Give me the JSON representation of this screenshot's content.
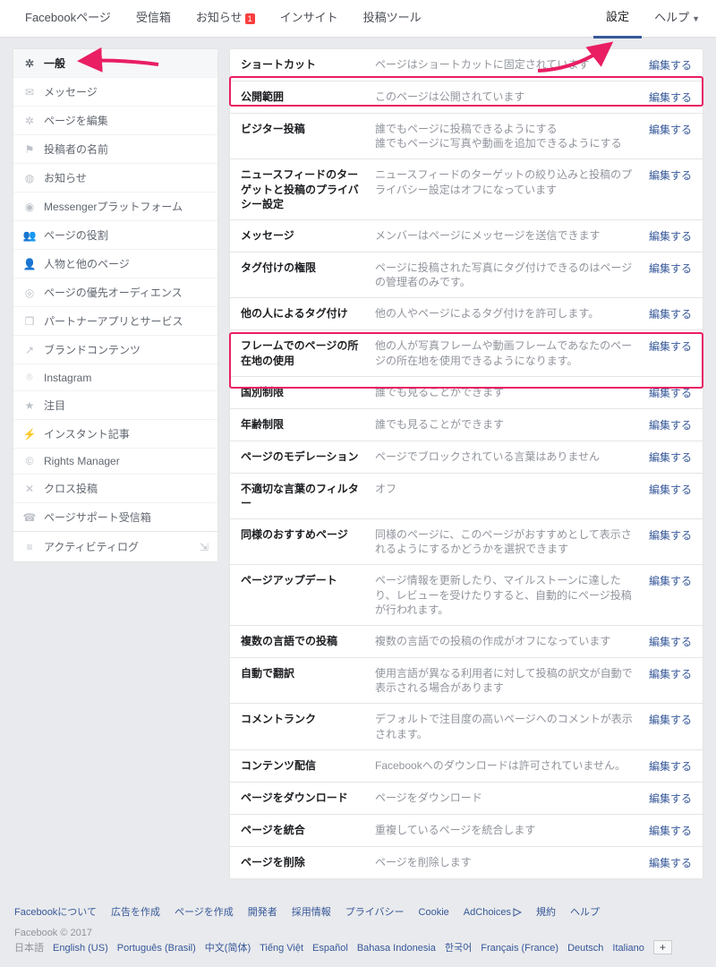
{
  "topnav": {
    "items": [
      {
        "label": "Facebookページ"
      },
      {
        "label": "受信箱"
      },
      {
        "label": "お知らせ",
        "badge": "1"
      },
      {
        "label": "インサイト"
      },
      {
        "label": "投稿ツール"
      }
    ],
    "settings": "設定",
    "help": "ヘルプ"
  },
  "sidebar": {
    "items": [
      {
        "icon": "gear",
        "label": "一般",
        "selected": true
      },
      {
        "icon": "message",
        "label": "メッセージ"
      },
      {
        "icon": "gear",
        "label": "ページを編集"
      },
      {
        "icon": "flag",
        "label": "投稿者の名前"
      },
      {
        "icon": "globe",
        "label": "お知らせ"
      },
      {
        "icon": "messenger",
        "label": "Messengerプラットフォーム"
      },
      {
        "icon": "people",
        "label": "ページの役割"
      },
      {
        "icon": "person",
        "label": "人物と他のページ"
      },
      {
        "icon": "target",
        "label": "ページの優先オーディエンス"
      },
      {
        "icon": "cube",
        "label": "パートナーアプリとサービス"
      },
      {
        "icon": "share",
        "label": "ブランドコンテンツ"
      },
      {
        "icon": "instagram",
        "label": "Instagram"
      },
      {
        "icon": "star",
        "label": "注目"
      },
      {
        "icon": "bolt",
        "label": "インスタント記事"
      },
      {
        "icon": "copyright",
        "label": "Rights Manager"
      },
      {
        "icon": "cross",
        "label": "クロス投稿"
      },
      {
        "icon": "support",
        "label": "ページサポート受信箱"
      }
    ],
    "activity_log": "アクティビティログ"
  },
  "settings_rows": [
    {
      "label": "ショートカット",
      "value": "ページはショートカットに固定されています",
      "edit": "編集する"
    },
    {
      "label": "公開範囲",
      "value": "このページは公開されています",
      "edit": "編集する"
    },
    {
      "label": "ビジター投稿",
      "value": "誰でもページに投稿できるようにする\n誰でもページに写真や動画を追加できるようにする",
      "edit": "編集する"
    },
    {
      "label": "ニュースフィードのターゲットと投稿のプライバシー設定",
      "value": "ニュースフィードのターゲットの絞り込みと投稿のプライバシー設定はオフになっています",
      "edit": "編集する"
    },
    {
      "label": "メッセージ",
      "value": "メンバーはページにメッセージを送信できます",
      "edit": "編集する"
    },
    {
      "label": "タグ付けの権限",
      "value": "ページに投稿された写真にタグ付けできるのはページの管理者のみです。",
      "edit": "編集する"
    },
    {
      "label": "他の人によるタグ付け",
      "value": "他の人やページによるタグ付けを許可します。",
      "edit": "編集する"
    },
    {
      "label": "フレームでのページの所在地の使用",
      "value": "他の人が写真フレームや動画フレームであなたのページの所在地を使用できるようになります。",
      "edit": "編集する"
    },
    {
      "label": "国別制限",
      "value": "誰でも見ることができます",
      "edit": "編集する"
    },
    {
      "label": "年齢制限",
      "value": "誰でも見ることができます",
      "edit": "編集する"
    },
    {
      "label": "ページのモデレーション",
      "value": "ページでブロックされている言葉はありません",
      "edit": "編集する"
    },
    {
      "label": "不適切な言葉のフィルター",
      "value": "オフ",
      "edit": "編集する"
    },
    {
      "label": "同様のおすすめページ",
      "value": "同様のページに、このページがおすすめとして表示されるようにするかどうかを選択できます",
      "edit": "編集する"
    },
    {
      "label": "ページアップデート",
      "value": "ページ情報を更新したり、マイルストーンに達したり、レビューを受けたりすると、自動的にページ投稿が行われます。",
      "edit": "編集する"
    },
    {
      "label": "複数の言語での投稿",
      "value": "複数の言語での投稿の作成がオフになっています",
      "edit": "編集する"
    },
    {
      "label": "自動で翻訳",
      "value": "使用言語が異なる利用者に対して投稿の訳文が自動で表示される場合があります",
      "edit": "編集する"
    },
    {
      "label": "コメントランク",
      "value": "デフォルトで注目度の高いページへのコメントが表示されます。",
      "edit": "編集する"
    },
    {
      "label": "コンテンツ配信",
      "value": "Facebookへのダウンロードは許可されていません。",
      "edit": "編集する"
    },
    {
      "label": "ページをダウンロード",
      "value": "ページをダウンロード",
      "edit": "編集する"
    },
    {
      "label": "ページを統合",
      "value": "重複しているページを統合します",
      "edit": "編集する"
    },
    {
      "label": "ページを削除",
      "value": "ページを削除します",
      "edit": "編集する"
    }
  ],
  "footer": {
    "links": [
      "Facebookについて",
      "広告を作成",
      "ページを作成",
      "開発者",
      "採用情報",
      "プライバシー",
      "Cookie",
      "AdChoices",
      "規約",
      "ヘルプ"
    ],
    "copyright": "Facebook © 2017",
    "current_lang": "日本語",
    "langs": [
      "English (US)",
      "Português (Brasil)",
      "中文(简体)",
      "Tiếng Việt",
      "Español",
      "Bahasa Indonesia",
      "한국어",
      "Français (France)",
      "Deutsch",
      "Italiano"
    ],
    "plus": "+"
  }
}
